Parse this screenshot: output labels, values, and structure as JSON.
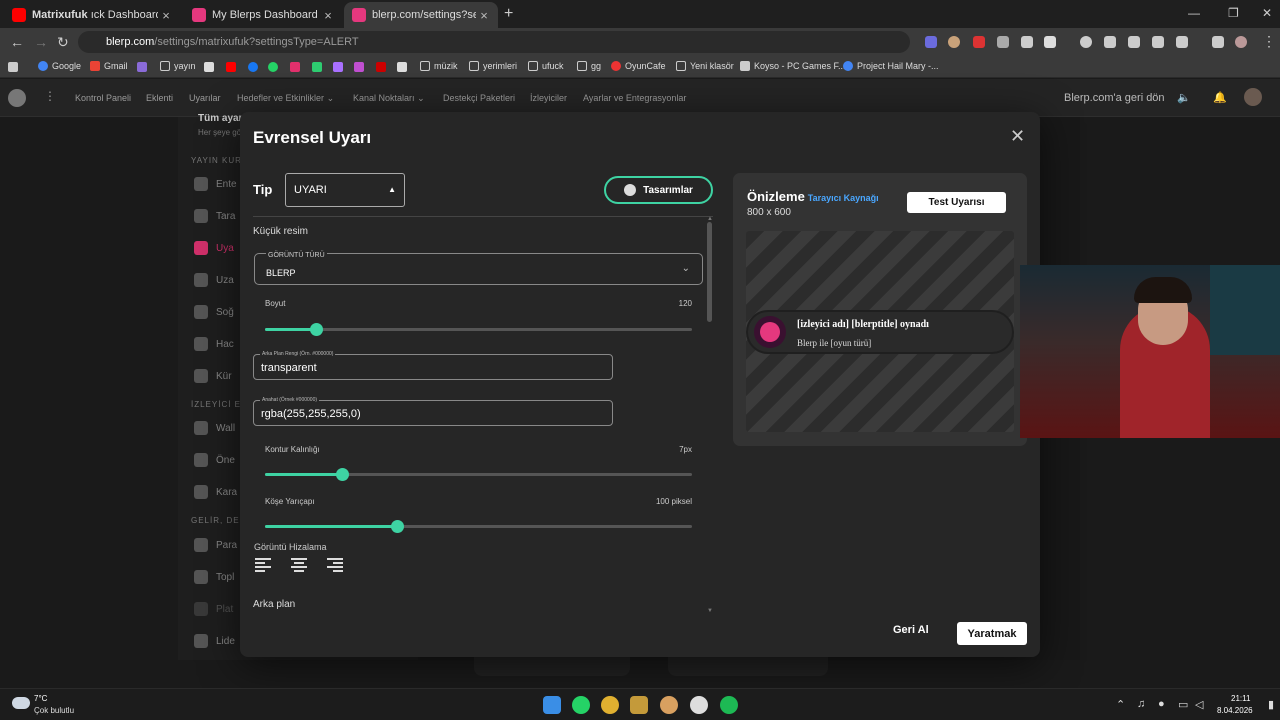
{
  "browser": {
    "tabs": [
      {
        "label": "Matrixufuk",
        "suffix": "ıck Dashboard"
      },
      {
        "label": "My Blerps Dashboard"
      },
      {
        "label": "blerp.com/settings?settingsTyp"
      }
    ],
    "url_host": "blerp.com",
    "url_path": "/settings/matrixufuk?settingsType=ALERT",
    "bookmarks": [
      "Google",
      "Gmail",
      "yayın",
      "müzik",
      "yerimleri",
      "ufuck",
      "gg",
      "OyunCafe",
      "Yeni klasör",
      "Koyso - PC Games F...",
      "Project Hail Mary -..."
    ]
  },
  "appnav": {
    "links": [
      "Kontrol Paneli",
      "Eklenti",
      "Uyarılar",
      "Hedefler ve Etkinlikler",
      "Kanal Noktaları",
      "Destekçi Paketleri",
      "İzleyiciler",
      "Ayarlar ve Entegrasyonlar"
    ],
    "back_link": "Blerp.com'a geri dön"
  },
  "sidebar": {
    "title": "Tüm ayar",
    "subtitle": "Her şeye gö",
    "section1": "YAYIN KUR",
    "section2": "İZLEYİCİ E",
    "section3": "GELİR, DES",
    "items": [
      "Ente",
      "Tara",
      "Uya",
      "Uza",
      "Soğ",
      "Hac",
      "Kür",
      "Wall",
      "Öne",
      "Kara",
      "Para",
      "Topl",
      "Plat",
      "Lide"
    ]
  },
  "modal": {
    "title": "Evrensel Uyarı",
    "type_label": "Tip",
    "type_value": "UYARI",
    "designs_button": "Tasarımlar",
    "thumbnail_section": "Küçük resim",
    "image_type_label": "GÖRÜNTÜ TÜRÜ",
    "image_type_value": "BLERP",
    "size_label": "Boyut",
    "size_value": "120",
    "size_fraction": 0.12,
    "bg_color_label": "Arka Plan Rengi (Örn. #000000)",
    "bg_color_value": "transparent",
    "outline_label": "Anahat (Örnek #000000)",
    "outline_value": "rgba(255,255,255,0)",
    "stroke_label": "Kontur Kalınlığı",
    "stroke_value": "7px",
    "stroke_fraction": 0.18,
    "radius_label": "Köşe Yarıçapı",
    "radius_value": "100 piksel",
    "radius_fraction": 0.31,
    "align_label": "Görüntü Hizalama",
    "background_section": "Arka plan",
    "cancel_button": "Geri Al",
    "create_button": "Yaratmak"
  },
  "preview": {
    "title": "Önizleme",
    "source": "Tarayıcı Kaynağı",
    "size": "800 x 600",
    "test_button": "Test Uyarısı",
    "alert_line1": "[izleyici adı] [blerptitle] oynadı",
    "alert_line2": "Blerp ile [oyun türü]"
  },
  "taskbar": {
    "temp": "7°C",
    "weather": "Çok bulutlu",
    "time": "21:11",
    "date": "8.04.2026"
  },
  "colors": {
    "accent": "#3ed3a3",
    "brand": "#d0306a",
    "link": "#4aa7ff"
  }
}
